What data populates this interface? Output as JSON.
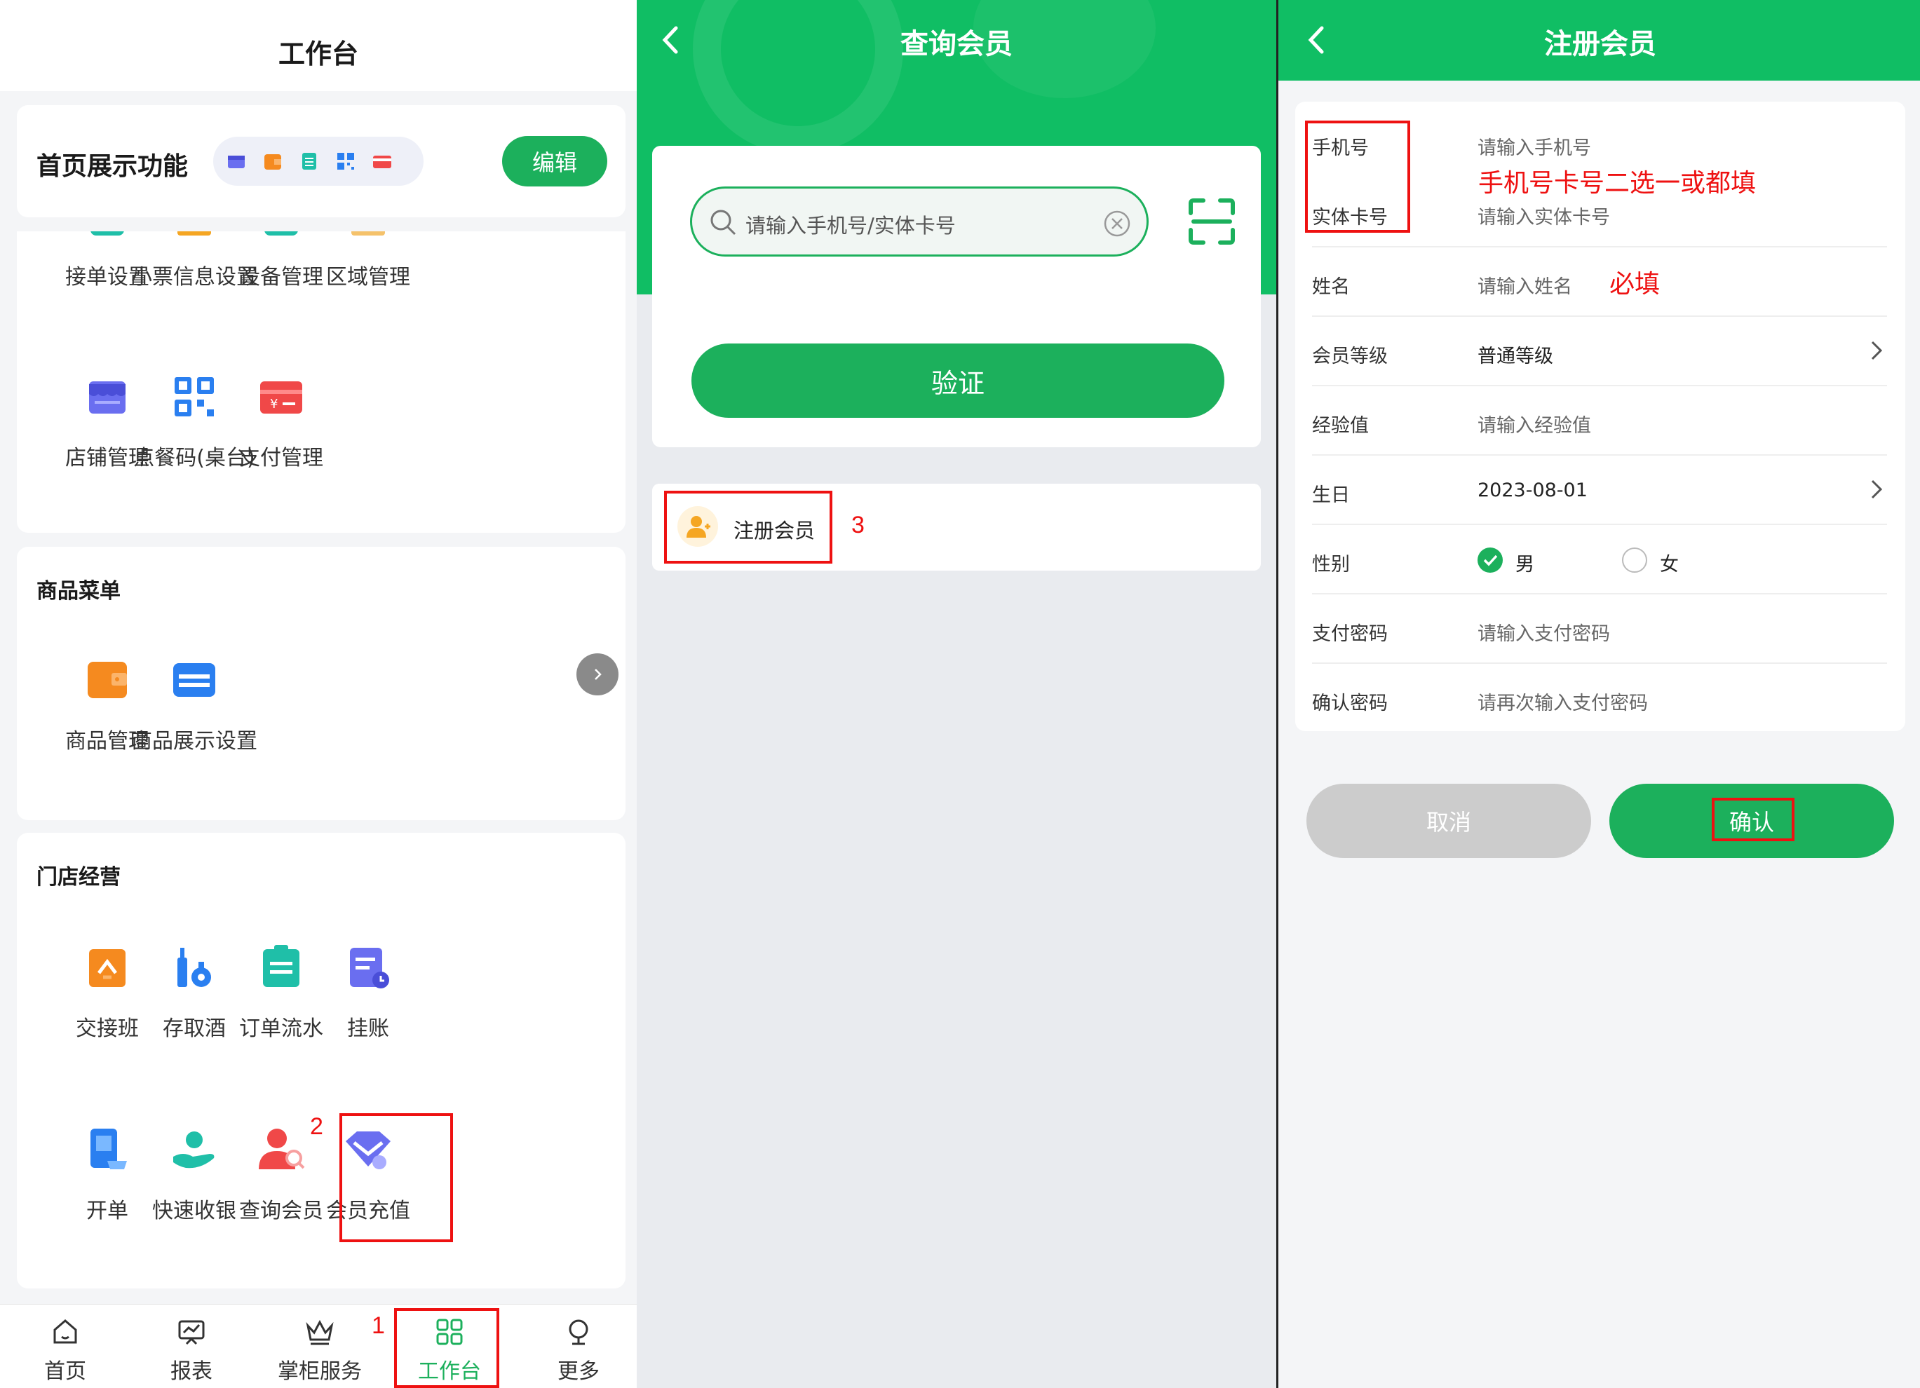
{
  "panel1": {
    "title": "工作台",
    "home_display": {
      "title": "首页展示功能",
      "edit_label": "编辑",
      "mini_icons": [
        "store-icon",
        "wallet-icon",
        "clipboard-icon",
        "qr-code-icon",
        "payment-card-icon"
      ]
    },
    "settings_row": [
      {
        "label": "接单设置",
        "icon": "order-settings-icon"
      },
      {
        "label": "小票信息设置",
        "icon": "receipt-settings-icon"
      },
      {
        "label": "设备管理",
        "icon": "device-icon"
      },
      {
        "label": "区域管理",
        "icon": "area-icon"
      }
    ],
    "shop_row": [
      {
        "label": "店铺管理",
        "icon": "store-icon"
      },
      {
        "label": "点餐码(桌台)",
        "icon": "qr-code-icon"
      },
      {
        "label": "支付管理",
        "icon": "payment-card-icon"
      }
    ],
    "goods_menu": {
      "title": "商品菜单",
      "items": [
        {
          "label": "商品管理",
          "icon": "wallet-icon"
        },
        {
          "label": "商品展示设置",
          "icon": "display-card-icon"
        }
      ]
    },
    "store_ops": {
      "title": "门店经营",
      "items": [
        {
          "label": "交接班",
          "icon": "shift-handover-icon"
        },
        {
          "label": "存取酒",
          "icon": "wine-storage-icon"
        },
        {
          "label": "订单流水",
          "icon": "order-list-icon"
        },
        {
          "label": "挂账",
          "icon": "credit-account-icon"
        },
        {
          "label": "开单",
          "icon": "open-order-icon"
        },
        {
          "label": "快速收银",
          "icon": "quick-cashier-icon"
        },
        {
          "label": "查询会员",
          "icon": "member-search-icon"
        },
        {
          "label": "会员充值",
          "icon": "member-recharge-icon"
        }
      ]
    },
    "tabs": [
      {
        "label": "首页",
        "icon": "home-icon"
      },
      {
        "label": "报表",
        "icon": "report-icon"
      },
      {
        "label": "掌柜服务",
        "icon": "crown-icon"
      },
      {
        "label": "工作台",
        "icon": "grid-icon"
      },
      {
        "label": "更多",
        "icon": "more-icon"
      }
    ],
    "annotations": {
      "step1": "1",
      "step2": "2"
    }
  },
  "panel2": {
    "title": "查询会员",
    "search_placeholder": "请输入手机号/实体卡号",
    "verify_label": "验证",
    "register_label": "注册会员",
    "annotation": "3"
  },
  "panel3": {
    "title": "注册会员",
    "fields": {
      "phone": {
        "label": "手机号",
        "placeholder": "请输入手机号"
      },
      "card": {
        "label": "实体卡号",
        "placeholder": "请输入实体卡号"
      },
      "name": {
        "label": "姓名",
        "placeholder": "请输入姓名"
      },
      "level": {
        "label": "会员等级",
        "value": "普通等级"
      },
      "exp": {
        "label": "经验值",
        "placeholder": "请输入经验值"
      },
      "birthday": {
        "label": "生日",
        "value": "2023-08-01"
      },
      "gender": {
        "label": "性别",
        "male": "男",
        "female": "女",
        "selected": "男"
      },
      "paypwd": {
        "label": "支付密码",
        "placeholder": "请输入支付密码"
      },
      "confirmpwd": {
        "label": "确认密码",
        "placeholder": "请再次输入支付密码"
      }
    },
    "annot_phone_card": "手机号卡号二选一或都填",
    "annot_required": "必填",
    "cancel_label": "取消",
    "confirm_label": "确认"
  },
  "colors": {
    "brand_green": "#1cb05c",
    "annotation_red": "#e11111"
  }
}
